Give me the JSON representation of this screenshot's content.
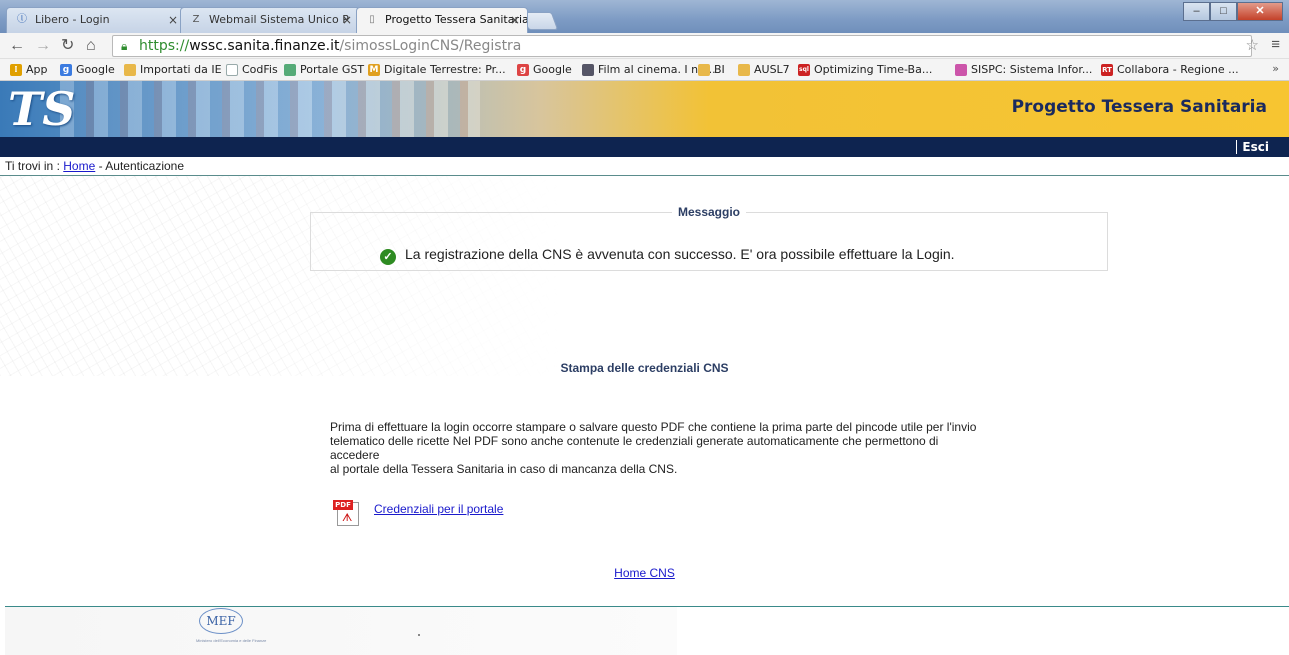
{
  "browser": {
    "tabs": [
      {
        "title": "Libero - Login",
        "favicon": "libero-icon"
      },
      {
        "title": "Webmail Sistema Unico P",
        "favicon": "zimbra-icon"
      },
      {
        "title": "Progetto Tessera Sanitaria",
        "favicon": "page-icon",
        "active": true
      }
    ],
    "address": {
      "scheme": "https://",
      "host": "wssc.sanita.finanze.it",
      "path": "/simossLoginCNS/Registra"
    },
    "bookmarks": [
      {
        "label": "App",
        "icon": "apps-grid-icon",
        "color": "#e0a000"
      },
      {
        "label": "Google",
        "icon": "google-icon",
        "color": "#3b7be0"
      },
      {
        "label": "Importati da IE",
        "icon": "folder-icon",
        "color": "#e8b84a"
      },
      {
        "label": "CodFis",
        "icon": "page-icon",
        "color": "#9aa"
      },
      {
        "label": "Portale GST",
        "icon": "chart-icon",
        "color": "#5a7"
      },
      {
        "label": "Digitale Terrestre: Pr...",
        "icon": "my-icon",
        "color": "#e0a020"
      },
      {
        "label": "Google",
        "icon": "google-plus-icon",
        "color": "#d44"
      },
      {
        "label": "Film al cinema. I nu...",
        "icon": "film-icon",
        "color": "#556"
      },
      {
        "label": "BI",
        "icon": "folder-icon",
        "color": "#e8b84a"
      },
      {
        "label": "AUSL7",
        "icon": "folder-icon",
        "color": "#e8b84a"
      },
      {
        "label": "Optimizing Time-Ba...",
        "icon": "sql-icon",
        "color": "#c22"
      },
      {
        "label": "SISPC: Sistema Infor...",
        "icon": "sispc-icon",
        "color": "#c5a"
      },
      {
        "label": "Collabora - Regione ...",
        "icon": "rt-icon",
        "color": "#c22"
      }
    ],
    "bookmarks_more": "»"
  },
  "header": {
    "logo": "TS",
    "title": "Progetto Tessera Sanitaria",
    "logout": "Esci"
  },
  "breadcrumb": {
    "prefix": "Ti trovi in :",
    "home": "Home",
    "sep": "-",
    "current": "Autenticazione"
  },
  "message": {
    "legend": "Messaggio",
    "text": "La registrazione della CNS è avvenuta con successo. E' ora possibile effettuare la Login."
  },
  "credentials": {
    "section_title": "Stampa delle credenziali CNS",
    "intro_lines": [
      "Prima di effettuare la login occorre stampare o salvare questo PDF che contiene la prima parte del pincode utile per l'invio",
      "telematico delle ricette Nel PDF sono anche contenute le credenziali generate automaticamente che permettono di accedere",
      "al portale della Tessera Sanitaria in caso di mancanza della CNS."
    ],
    "pdf_badge": "PDF",
    "pdf_link": "Credenziali per il portale"
  },
  "home_cns": "Home CNS",
  "footer": {
    "logo": "MEF",
    "caption": "Ministero dell'Economia e delle Finanze"
  }
}
